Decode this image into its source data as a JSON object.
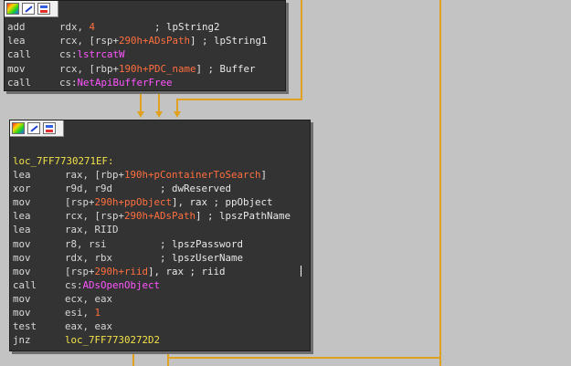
{
  "graph": {
    "colors": {
      "background": "#c3c3c3",
      "node_bg": "#333333",
      "edge": "#e0a020",
      "register": "#d7d7d7",
      "symbol": "#ff6f3f",
      "label": "#f2e14a",
      "import": "#ff55ff"
    }
  },
  "node_top": {
    "toolbar": [
      "color-picker-icon",
      "rename-icon",
      "graph-overview-icon"
    ],
    "lines": [
      {
        "mnemonic": "add",
        "op": "rdx, ",
        "imm": "4",
        "comment": "          ; lpString2"
      },
      {
        "mnemonic": "lea",
        "op": "rcx, [rsp+",
        "sym1": "290h",
        "sym2": "+ADsPath",
        "tail": "] ; lpString1"
      },
      {
        "mnemonic": "call",
        "op": "cs:",
        "api": "lstrcatW"
      },
      {
        "mnemonic": "mov",
        "op": "rcx, [rbp+",
        "sym1": "190h",
        "sym2": "+PDC_name",
        "tail": "] ; Buffer"
      },
      {
        "mnemonic": "call",
        "op": "cs:",
        "api": "NetApiBufferFree"
      }
    ]
  },
  "node_main": {
    "toolbar": [
      "color-picker-icon",
      "rename-icon",
      "graph-overview-icon"
    ],
    "label": "loc_7FF7730271EF:",
    "lines": [
      {
        "mnemonic": "lea",
        "op": "rax, [rbp+",
        "sym1": "190h",
        "sym2": "+pContainerToSearch",
        "tail": "]"
      },
      {
        "mnemonic": "xor",
        "op": "r9d, r9d",
        "tail": "        ; dwReserved"
      },
      {
        "mnemonic": "mov",
        "op": "[rsp+",
        "sym1": "290h",
        "sym2": "+ppObject",
        "tail": "], rax ; ppObject"
      },
      {
        "mnemonic": "lea",
        "op": "rcx, [rsp+",
        "sym1": "290h",
        "sym2": "+ADsPath",
        "tail": "] ; lpszPathName"
      },
      {
        "mnemonic": "lea",
        "op": "rax, RIID"
      },
      {
        "mnemonic": "mov",
        "op": "r8, rsi",
        "tail": "         ; lpszPassword"
      },
      {
        "mnemonic": "mov",
        "op": "rdx, rbx",
        "tail": "        ; lpszUserName"
      },
      {
        "mnemonic": "mov",
        "op": "[rsp+",
        "sym1": "290h",
        "sym2": "+riid",
        "tail": "], rax ; riid"
      },
      {
        "mnemonic": "call",
        "op": "cs:",
        "api": "ADsOpenObject"
      },
      {
        "mnemonic": "mov",
        "op": "ecx, eax"
      },
      {
        "mnemonic": "mov",
        "op": "esi, ",
        "imm": "1"
      },
      {
        "mnemonic": "test",
        "op": "eax, eax"
      },
      {
        "mnemonic": "jnz",
        "loc": "loc_7FF7730272D2"
      }
    ]
  }
}
